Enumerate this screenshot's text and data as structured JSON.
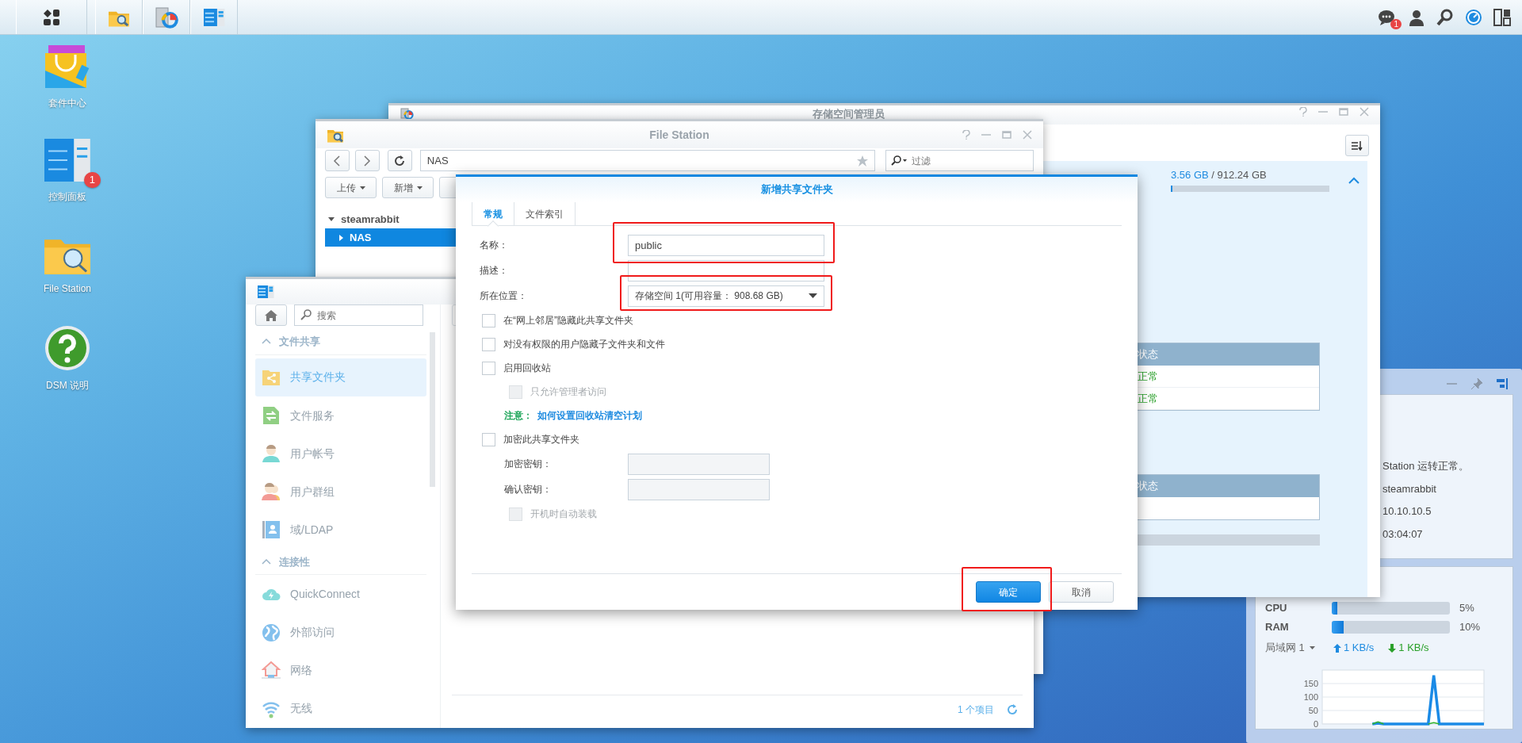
{
  "taskbar": {
    "notification_count": "1"
  },
  "desktop_icons": [
    {
      "label": "套件中心",
      "kind": "package"
    },
    {
      "label": "控制面板",
      "kind": "control",
      "badge": "1"
    },
    {
      "label": "File Station",
      "kind": "files"
    },
    {
      "label": "DSM 说明",
      "kind": "help"
    }
  ],
  "storage_window": {
    "title": "存储空间管理员",
    "used": "3.56 GB",
    "total": "/ 912.24 GB",
    "level": 0.004,
    "tables": [
      {
        "header": "状态",
        "rows": [
          "正常",
          "正常"
        ]
      },
      {
        "header": "状态"
      }
    ]
  },
  "file_station": {
    "title": "File Station",
    "path": "NAS",
    "filter_placeholder": "过滤",
    "toolbar": [
      {
        "label": "上传"
      },
      {
        "label": "新增"
      }
    ],
    "tree": [
      {
        "label": "steamrabbit",
        "expanded": true,
        "selected": false,
        "children": [
          {
            "label": "NAS",
            "expanded": false,
            "selected": true
          }
        ]
      }
    ]
  },
  "control_panel": {
    "search_placeholder": "搜索",
    "sections": [
      {
        "title": "文件共享",
        "items": [
          {
            "label": "共享文件夹",
            "kind": "share-folder",
            "selected": true
          },
          {
            "label": "文件服务",
            "kind": "file-service",
            "selected": false
          },
          {
            "label": "用户帐号",
            "kind": "user",
            "selected": false
          },
          {
            "label": "用户群组",
            "kind": "group",
            "selected": false
          },
          {
            "label": "域/LDAP",
            "kind": "directory",
            "selected": false
          }
        ]
      },
      {
        "title": "连接性",
        "items": [
          {
            "label": "QuickConnect",
            "kind": "cloud",
            "selected": false
          },
          {
            "label": "外部访问",
            "kind": "globe",
            "selected": false
          },
          {
            "label": "网络",
            "kind": "house",
            "selected": false
          },
          {
            "label": "无线",
            "kind": "wifi",
            "selected": false
          }
        ]
      }
    ],
    "footer_count": "1 个项目"
  },
  "dialog": {
    "title": "新增共享文件夹",
    "tabs": [
      {
        "label": "常规",
        "selected": true
      },
      {
        "label": "文件索引",
        "selected": false
      }
    ],
    "fields": [
      {
        "label": "名称：",
        "kind": "text",
        "value": "public"
      },
      {
        "label": "描述：",
        "kind": "text"
      },
      {
        "label": "所在位置：",
        "kind": "select",
        "value": "存储空间 1(可用容量： 908.68 GB)"
      }
    ],
    "options": [
      {
        "kind": "checkbox",
        "label": "在“网上邻居”隐藏此共享文件夹",
        "checked": false,
        "disabled": false,
        "nested": false
      },
      {
        "kind": "checkbox",
        "label": "对没有权限的用户隐藏子文件夹和文件",
        "checked": false,
        "disabled": false,
        "nested": false
      },
      {
        "kind": "checkbox",
        "label": "启用回收站",
        "checked": false,
        "disabled": false,
        "nested": false
      },
      {
        "kind": "checkbox",
        "label": "只允许管理者访问",
        "checked": false,
        "disabled": true,
        "nested": true
      },
      {
        "kind": "note",
        "label": "注意：",
        "link": "如何设置回收站清空计划"
      },
      {
        "kind": "checkbox",
        "label": "加密此共享文件夹",
        "checked": false,
        "disabled": false,
        "nested": false
      },
      {
        "kind": "password",
        "label": "加密密钥："
      },
      {
        "kind": "password",
        "label": "确认密钥："
      },
      {
        "kind": "checkbox",
        "label": "开机时自动装载",
        "checked": false,
        "disabled": true,
        "nested": true
      }
    ],
    "buttons": [
      {
        "label": "确定",
        "kind": "primary"
      },
      {
        "label": "取消",
        "kind": "secondary"
      }
    ]
  },
  "widget": {
    "health_lines": [
      "Station 运转正常。",
      "steamrabbit",
      "10.10.10.5",
      "03:04:07"
    ],
    "meters": [
      {
        "name": "CPU",
        "level": 0.05,
        "reading": "5%"
      },
      {
        "name": "RAM",
        "level": 0.1,
        "reading": "10%"
      }
    ],
    "network": {
      "interface": "局域网 1",
      "upload": "1 KB/s",
      "download": "1 KB/s",
      "chart_data": {
        "type": "line",
        "grid": true,
        "ylim": [
          0,
          200
        ],
        "yticks": [
          0,
          50,
          100,
          150
        ],
        "series": [
          {
            "color": "#1a8ae6",
            "values": [
              null,
              null,
              null,
              null,
              null,
              null,
              null,
              null,
              null,
              0,
              3,
              0,
              0,
              0,
              0,
              0,
              0,
              0,
              0,
              0,
              180,
              0,
              0,
              0,
              0,
              0,
              0,
              0,
              0,
              0
            ]
          },
          {
            "color": "#33b52e",
            "values": [
              null,
              null,
              null,
              null,
              null,
              null,
              null,
              null,
              null,
              0,
              8,
              0,
              null,
              null,
              null,
              null,
              null,
              null,
              null,
              0,
              5,
              0,
              null,
              null,
              null,
              null,
              null,
              null,
              null,
              null
            ]
          }
        ]
      }
    }
  }
}
